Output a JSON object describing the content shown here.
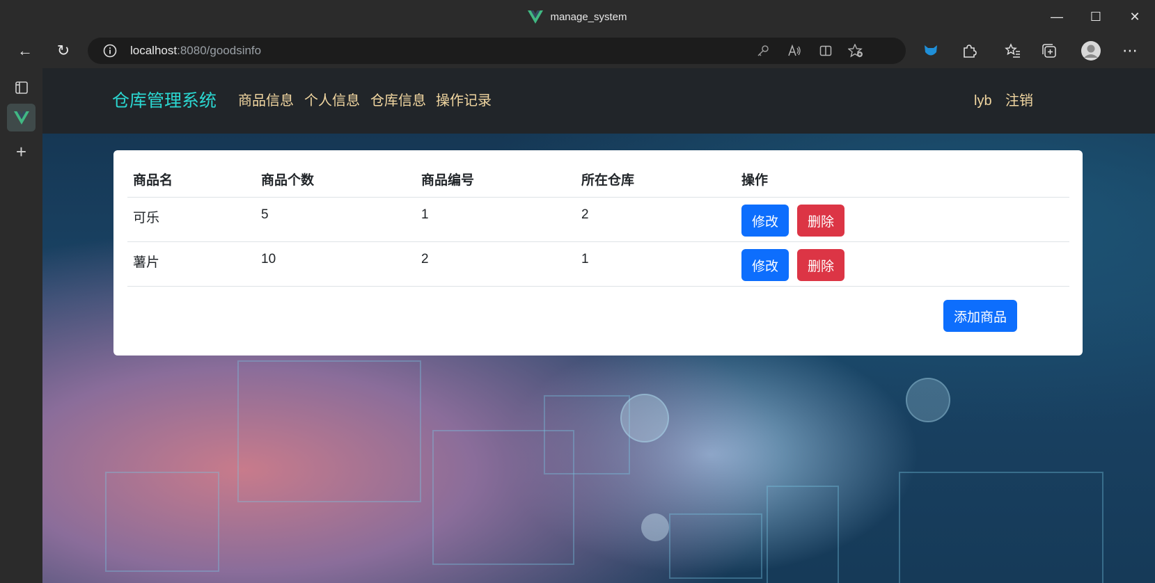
{
  "window": {
    "title": "manage_system",
    "minimize": "—",
    "maximize": "☐",
    "close": "✕"
  },
  "browser": {
    "address_host": "localhost",
    "address_rest": ":8080/goodsinfo",
    "back": "←",
    "refresh": "↻",
    "more": "⋯"
  },
  "navbar": {
    "brand": "仓库管理系统",
    "links": [
      "商品信息",
      "个人信息",
      "仓库信息",
      "操作记录"
    ],
    "user": "lyb",
    "logout": "注销"
  },
  "table": {
    "headers": [
      "商品名",
      "商品个数",
      "商品编号",
      "所在仓库",
      "操作"
    ],
    "rows": [
      {
        "name": "可乐",
        "count": "5",
        "id": "1",
        "warehouse": "2"
      },
      {
        "name": "薯片",
        "count": "10",
        "id": "2",
        "warehouse": "1"
      }
    ],
    "edit_label": "修改",
    "delete_label": "删除",
    "add_label": "添加商品"
  },
  "colors": {
    "brand": "#2bd7d1",
    "navlink": "#f2d7a1",
    "primary": "#0d6efd",
    "danger": "#dc3545",
    "navbar_bg": "#212529"
  }
}
